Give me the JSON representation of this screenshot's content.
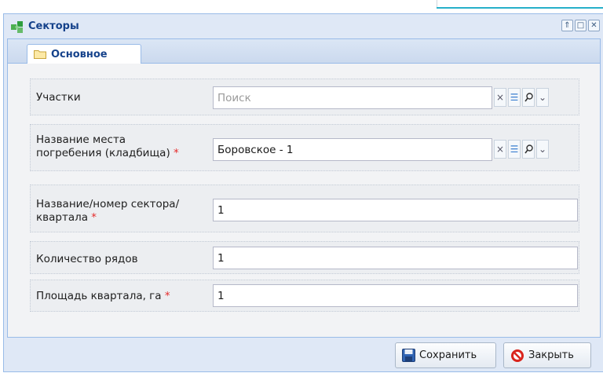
{
  "window": {
    "title": "Секторы",
    "tools": [
      "⇑",
      "□",
      "✕"
    ]
  },
  "tabs": [
    {
      "label": "Основное",
      "active": true
    }
  ],
  "form": {
    "uchastki": {
      "label": "Участки",
      "placeholder": "Поиск",
      "value": ""
    },
    "kladbishe": {
      "label_line1": "Название места",
      "label_line2": "погребения (кладбища)",
      "required_mark": "*",
      "value": "Боровское - 1"
    },
    "sektor": {
      "label_line1": "Название/номер сектора/",
      "label_line2": "квартала",
      "required_mark": "*",
      "value": "1"
    },
    "ryady": {
      "label": "Количество рядов",
      "value": "1"
    },
    "ploshad": {
      "label": "Площадь квартала, га",
      "required_mark": "*",
      "value": "1"
    }
  },
  "trigger_icons": [
    "clear-icon",
    "list-icon",
    "search-icon",
    "chevron-down-icon"
  ],
  "trigger_glyphs": {
    "clear": "×",
    "list": "☰",
    "dropdown": "⌄"
  },
  "buttons": {
    "save": "Сохранить",
    "close": "Закрыть"
  },
  "colors": {
    "accent": "#27b0c9",
    "title": "#15428b",
    "required": "#e52b2b"
  }
}
